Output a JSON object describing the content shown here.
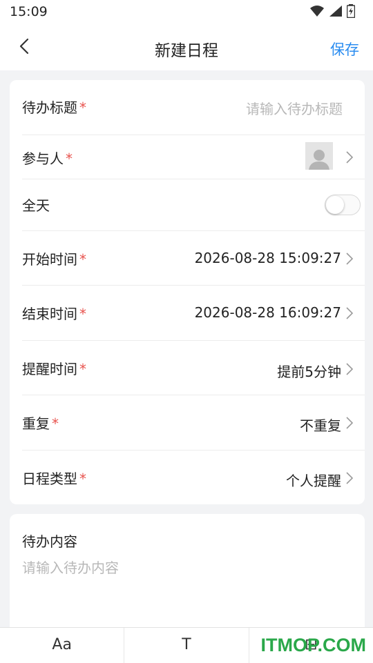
{
  "status": {
    "time": "15:09"
  },
  "nav": {
    "title": "新建日程",
    "save": "保存"
  },
  "form": {
    "title_label": "待办标题",
    "title_placeholder": "请输入待办标题",
    "participant_label": "参与人",
    "allday_label": "全天",
    "allday_on": false,
    "start_label": "开始时间",
    "start_value": "2026-08-28 15:09:27",
    "end_label": "结束时间",
    "end_value": "2026-08-28 16:09:27",
    "remind_label": "提醒时间",
    "remind_value": "提前5分钟",
    "repeat_label": "重复",
    "repeat_value": "不重复",
    "type_label": "日程类型",
    "type_value": "个人提醒",
    "required_mark": "*"
  },
  "content": {
    "label": "待办内容",
    "placeholder": "请输入待办内容"
  },
  "toolbar": {
    "items": [
      "Aa",
      "T",
      "⊟",
      "⊙"
    ]
  },
  "watermark": "ITMOP.COM",
  "colors": {
    "accent": "#2a8cf0",
    "required": "#e8534e",
    "watermark": "#2aa84a"
  }
}
